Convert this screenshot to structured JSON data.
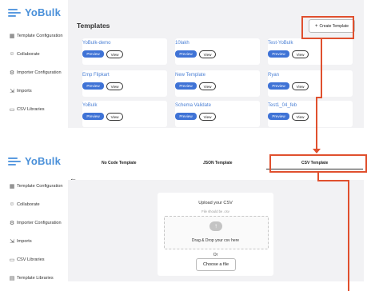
{
  "brand": {
    "name": "YoBulk"
  },
  "sidebar_items": [
    {
      "label": "Template Configuration",
      "icon": "grid-icon"
    },
    {
      "label": "Collaborate",
      "icon": "users-icon"
    },
    {
      "label": "Importer Configuration",
      "icon": "gear-icon"
    },
    {
      "label": "Imports",
      "icon": "import-icon"
    },
    {
      "label": "CSV Libraries",
      "icon": "folder-icon"
    },
    {
      "label": "Template Libraries",
      "icon": "library-icon"
    }
  ],
  "templates_page": {
    "title": "Templates",
    "create_button": "Create Template",
    "preview_label": "Preview",
    "view_label": "View",
    "cards": [
      {
        "name": "YoBulk-demo"
      },
      {
        "name": "10lakh"
      },
      {
        "name": "Test-YoBulk"
      },
      {
        "name": "Emp Flipkart"
      },
      {
        "name": "New Template"
      },
      {
        "name": "Ryan"
      },
      {
        "name": "YoBulk"
      },
      {
        "name": "Schema Validate"
      },
      {
        "name": "Test1_04_feb"
      }
    ]
  },
  "create_page": {
    "tabs": [
      "No Code Template",
      "JSON Template",
      "CSV Template"
    ],
    "upload_title": "Upload your CSV",
    "upload_subtitle": "File should be .csv",
    "drop_text": "Drag & Drop your csv here",
    "or_text": "Or",
    "choose_button": "Choose a file"
  },
  "colors": {
    "accent": "#3f73d6",
    "highlight": "#e0502e",
    "brand": "#4a90d9"
  }
}
